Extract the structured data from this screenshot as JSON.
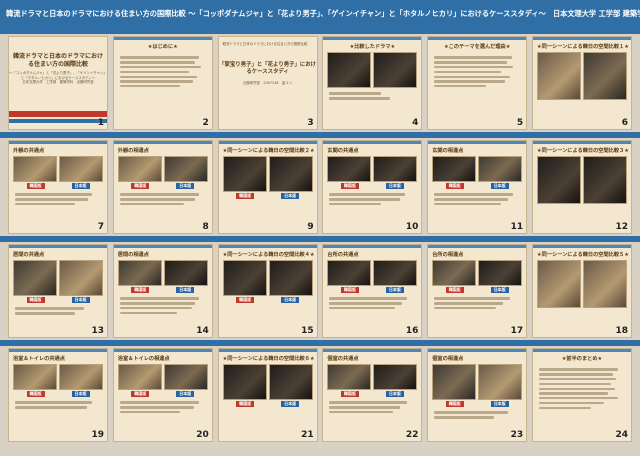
{
  "header": {
    "title": "韓流ドラマと日本のドラマにおける住まい方の国際比較 〜「コッポダナムジャ」と「花より男子」、「ゲインイチャン」と「ホタルノヒカリ」におけるケーススタディ〜　日本文理大学 工学部 建築学科 近藤研究室 キム ユリ ＆ キム イナ"
  },
  "slides": [
    {
      "num": "1",
      "title": "韓流ドラマと日本のドラマにおける住まい方の国際比較",
      "sub1": "〜「コッポダナムジャ」と「花より男子」、「ゲインイチャン」と「ホタルノヒカリ」におけるケーススタディ〜",
      "sub2": "日本文理大学　工学部　建築学科　近藤研究室"
    },
    {
      "num": "2",
      "title": "★はじめに★"
    },
    {
      "num": "3",
      "top": "韓流ドラマと日本のドラマにおける住まい方の国際比較",
      "title": "「家宝り男子」と「花より男子」におけるケーススタディ",
      "sub": "近藤研究室　2007248　金ユリ"
    },
    {
      "num": "4",
      "title": "★比較したドラマ★"
    },
    {
      "num": "5",
      "title": "★このテーマを選んだ理由★"
    },
    {
      "num": "6",
      "title": "★同一シーンによる韓日の空間比較１★"
    },
    {
      "num": "7",
      "title": "外観の共通点",
      "kr": "韓国版",
      "jp": "日本版"
    },
    {
      "num": "8",
      "title": "外観の相違点",
      "kr": "韓国版",
      "jp": "日本版"
    },
    {
      "num": "9",
      "title": "★同一シーンによる韓日の空間比較２★",
      "kr": "韓国版",
      "jp": "日本版"
    },
    {
      "num": "10",
      "title": "玄関の共通点",
      "kr": "韓国版",
      "jp": "日本版"
    },
    {
      "num": "11",
      "title": "玄関の相違点",
      "kr": "韓国版",
      "jp": "日本版"
    },
    {
      "num": "12",
      "title": "★同一シーンによる韓日の空間比較３★"
    },
    {
      "num": "13",
      "title": "居間の共通点",
      "kr": "韓国版",
      "jp": "日本版"
    },
    {
      "num": "14",
      "title": "居間の相違点",
      "kr": "韓国版",
      "jp": "日本版"
    },
    {
      "num": "15",
      "title": "★同一シーンによる韓日の空間比較４★",
      "kr": "韓国版",
      "jp": "日本版"
    },
    {
      "num": "16",
      "title": "台所の共通点",
      "kr": "韓国版",
      "jp": "日本版"
    },
    {
      "num": "17",
      "title": "台所の相違点",
      "kr": "韓国版",
      "jp": "日本版"
    },
    {
      "num": "18",
      "title": "★同一シーンによる韓日の空間比較５★"
    },
    {
      "num": "19",
      "title": "浴室＆トイレの共通点",
      "kr": "韓国版",
      "jp": "日本版"
    },
    {
      "num": "20",
      "title": "浴室＆トイレの相違点",
      "kr": "韓国版",
      "jp": "日本版"
    },
    {
      "num": "21",
      "title": "★同一シーンによる韓日の空間比較６★",
      "kr": "韓国版",
      "jp": "日本版"
    },
    {
      "num": "22",
      "title": "個室の共通点",
      "kr": "韓国版",
      "jp": "日本版"
    },
    {
      "num": "23",
      "title": "個室の相違点",
      "kr": "韓国版",
      "jp": "日本版"
    },
    {
      "num": "24",
      "title": "★前半のまとめ★"
    }
  ]
}
